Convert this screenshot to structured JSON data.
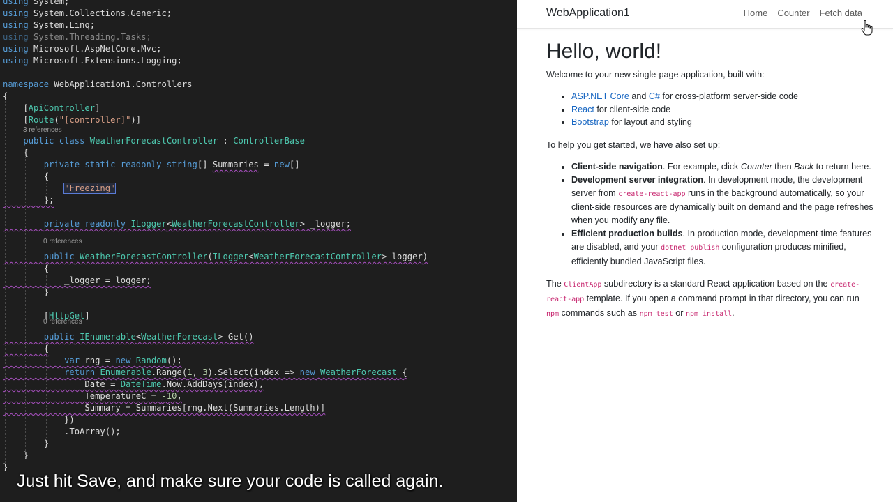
{
  "editor": {
    "using_lines": [
      "using System;",
      "using System.Collections.Generic;",
      "using System.Linq;",
      "using System.Threading.Tasks;",
      "using Microsoft.AspNetCore.Mvc;",
      "using Microsoft.Extensions.Logging;"
    ],
    "namespace_keyword": "namespace",
    "namespace_name": "WebApplication1.Controllers",
    "attr_api_controller": "ApiController",
    "attr_route": "Route",
    "route_value": "\"[controller]\"",
    "refs_3": "3 references",
    "refs_0a": "0 references",
    "refs_0b": "0 references",
    "class_name": "WeatherForecastController",
    "base_class": "ControllerBase",
    "summaries_name": "Summaries",
    "freezing_value": "Freezing",
    "logger_type": "ILogger",
    "logger_field": "_logger",
    "logger_param": "logger",
    "http_get": "HttpGet",
    "forecast_type": "WeatherForecast",
    "get_method": "Get",
    "temperature_value": "-10"
  },
  "caption": "Just hit Save, and make sure your code is called again.",
  "app": {
    "brand": "WebApplication1",
    "nav": [
      "Home",
      "Counter",
      "Fetch data"
    ],
    "heading": "Hello, world!",
    "intro": "Welcome to your new single-page application, built with:",
    "stack": [
      {
        "links": [
          "ASP.NET Core",
          "C#"
        ],
        "joiner": " and ",
        "text": " for cross-platform server-side code"
      },
      {
        "links": [
          "React"
        ],
        "text": " for client-side code"
      },
      {
        "links": [
          "Bootstrap"
        ],
        "text": " for layout and styling"
      }
    ],
    "setup_intro": "To help you get started, we have also set up:",
    "features": {
      "nav_title": "Client-side navigation",
      "nav_text_1": ". For example, click ",
      "nav_counter": "Counter",
      "nav_text_2": " then ",
      "nav_back": "Back",
      "nav_text_3": " to return here.",
      "dev_title": "Development server integration",
      "dev_text_1": ". In development mode, the development server from ",
      "dev_code": "create-react-app",
      "dev_text_2": " runs in the background automatically, so your client-side resources are dynamically built on demand and the page refreshes when you modify any file.",
      "prod_title": "Efficient production builds",
      "prod_text_1": ". In production mode, development-time features are disabled, and your ",
      "prod_code": "dotnet publish",
      "prod_text_2": " configuration produces minified, efficiently bundled JavaScript files."
    },
    "footer": {
      "t1": "The ",
      "c1": "ClientApp",
      "t2": " subdirectory is a standard React application based on the ",
      "c2": "create-react-app",
      "t3": " template. If you open a command prompt in that directory, you can run ",
      "c3": "npm",
      "t4": " commands such as ",
      "c4": "npm test",
      "t5": " or ",
      "c5": "npm install",
      "t6": "."
    }
  }
}
